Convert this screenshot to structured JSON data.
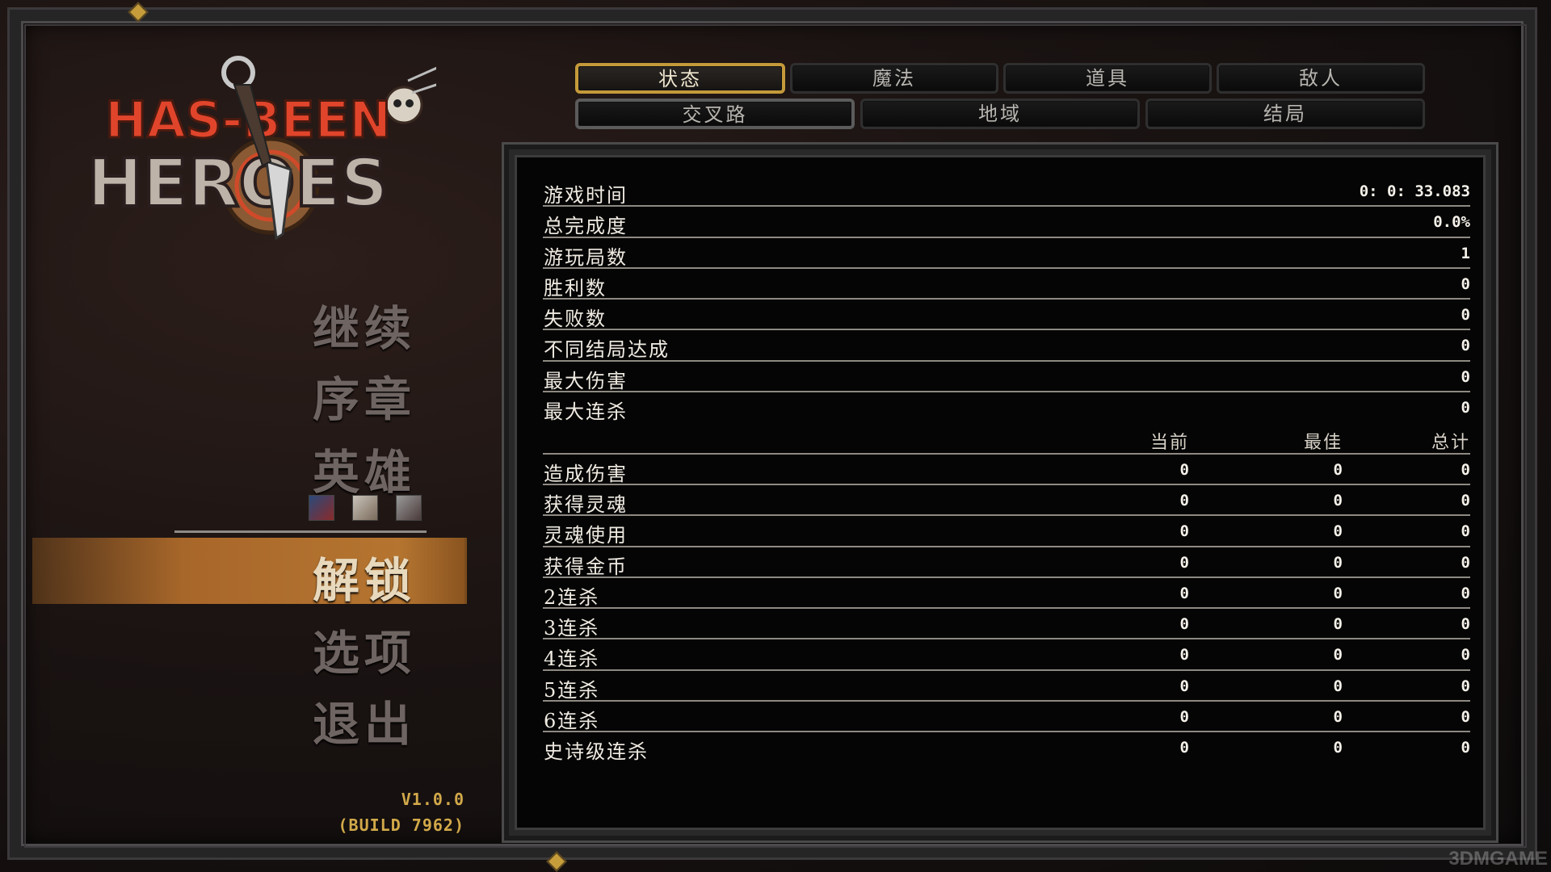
{
  "logo": {
    "line1": "HAS-BEEN",
    "line2": "HEROES"
  },
  "menu": {
    "items": [
      {
        "label": "继续"
      },
      {
        "label": "序章"
      },
      {
        "label": "英雄"
      },
      {
        "label": "解锁"
      },
      {
        "label": "选项"
      },
      {
        "label": "退出"
      }
    ],
    "active": "解锁"
  },
  "version": {
    "line1": "V1.0.0",
    "line2": "(BUILD 7962)"
  },
  "tabs": {
    "row1": [
      "状态",
      "魔法",
      "道具",
      "敌人"
    ],
    "row2": [
      "交叉路",
      "地域",
      "结局"
    ],
    "active": "状态"
  },
  "stats": {
    "general": [
      {
        "label": "游戏时间",
        "value": "0: 0: 33.083"
      },
      {
        "label": "总完成度",
        "value": "0.0%"
      },
      {
        "label": "游玩局数",
        "value": "1"
      },
      {
        "label": "胜利数",
        "value": "0"
      },
      {
        "label": "失败数",
        "value": "0"
      },
      {
        "label": "不同结局达成",
        "value": "0"
      },
      {
        "label": "最大伤害",
        "value": "0"
      },
      {
        "label": "最大连杀",
        "value": "0"
      }
    ],
    "columns": {
      "current": "当前",
      "best": "最佳",
      "total": "总计"
    },
    "tracked": [
      {
        "label": "造成伤害",
        "current": "0",
        "best": "0",
        "total": "0"
      },
      {
        "label": "获得灵魂",
        "current": "0",
        "best": "0",
        "total": "0"
      },
      {
        "label": "灵魂使用",
        "current": "0",
        "best": "0",
        "total": "0"
      },
      {
        "label": "获得金币",
        "current": "0",
        "best": "0",
        "total": "0"
      },
      {
        "label": "2连杀",
        "current": "0",
        "best": "0",
        "total": "0"
      },
      {
        "label": "3连杀",
        "current": "0",
        "best": "0",
        "total": "0"
      },
      {
        "label": "4连杀",
        "current": "0",
        "best": "0",
        "total": "0"
      },
      {
        "label": "5连杀",
        "current": "0",
        "best": "0",
        "total": "0"
      },
      {
        "label": "6连杀",
        "current": "0",
        "best": "0",
        "total": "0"
      },
      {
        "label": "史诗级连杀",
        "current": "0",
        "best": "0",
        "total": "0"
      }
    ]
  },
  "watermark": "3DMGAME",
  "colors": {
    "accent_gold": "#c49a3a",
    "highlight_orange": "#b57530",
    "logo_red": "#e0452b"
  }
}
